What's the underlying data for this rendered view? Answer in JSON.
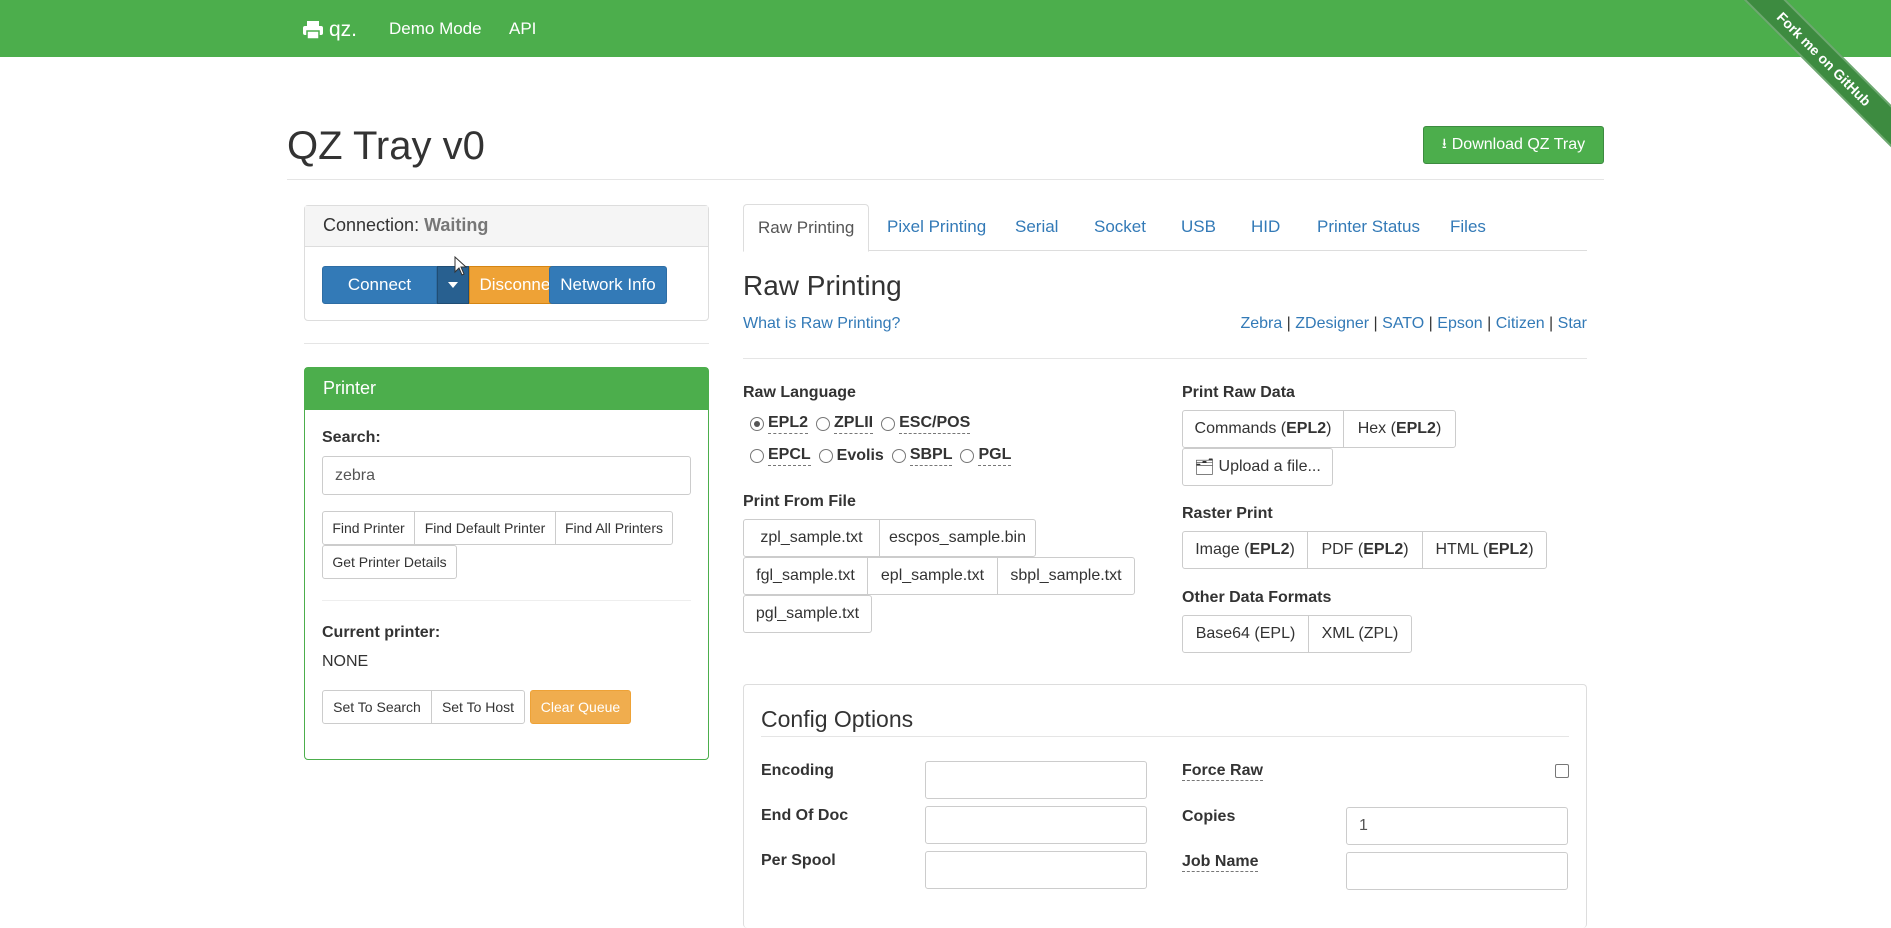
{
  "navbar": {
    "brand": "qz.",
    "links": [
      "Demo Mode",
      "API"
    ],
    "ribbon": "Fork me on GitHub"
  },
  "header": {
    "title": "QZ Tray v0",
    "download_label": "Download QZ Tray"
  },
  "connection": {
    "label": "Connection:",
    "status": "Waiting",
    "connect_label": "Connect",
    "disconnect_label": "Disconnect",
    "network_label": "Network Info"
  },
  "printer": {
    "heading": "Printer",
    "search_label": "Search:",
    "search_value": "zebra",
    "buttons": [
      "Find Printer",
      "Find Default Printer",
      "Find All Printers",
      "Get Printer Details"
    ],
    "current_label": "Current printer:",
    "current_value": "NONE",
    "bottom_buttons": [
      "Set To Search",
      "Set To Host",
      "Clear Queue"
    ]
  },
  "tabs": [
    "Raw Printing",
    "Pixel Printing",
    "Serial",
    "Socket",
    "USB",
    "HID",
    "Printer Status",
    "Files"
  ],
  "raw": {
    "title": "Raw Printing",
    "what_link": "What is Raw Printing?",
    "vendors": [
      "Zebra",
      "ZDesigner",
      "SATO",
      "Epson",
      "Citizen",
      "Star"
    ],
    "language_label": "Raw Language",
    "languages": [
      "EPL2",
      "ZPLII",
      "ESC/POS",
      "EPCL",
      "Evolis",
      "SBPL",
      "PGL"
    ],
    "selected_language": "EPL2",
    "from_file_label": "Print From File",
    "files": [
      "zpl_sample.txt",
      "escpos_sample.bin",
      "fgl_sample.txt",
      "epl_sample.txt",
      "sbpl_sample.txt",
      "pgl_sample.txt"
    ],
    "raw_data_label": "Print Raw Data",
    "commands_prefix": "Commands (",
    "hex_prefix": "Hex (",
    "lang_bold": "EPL2",
    "close_paren": ")",
    "upload_label": "Upload a file...",
    "raster_label": "Raster Print",
    "image_prefix": "Image (",
    "pdf_prefix": "PDF (",
    "html_prefix": "HTML (",
    "other_label": "Other Data Formats",
    "base64_label": "Base64 (EPL)",
    "xml_label": "XML (ZPL)"
  },
  "config": {
    "title": "Config Options",
    "encoding_label": "Encoding",
    "end_of_doc_label": "End Of Doc",
    "per_spool_label": "Per Spool",
    "force_raw_label": "Force Raw",
    "copies_label": "Copies",
    "copies_value": "1",
    "job_name_label": "Job Name"
  },
  "colors": {
    "navbar": "#4cae4c",
    "primary": "#337ab7",
    "warning": "#eea236",
    "success": "#4cae4c"
  }
}
